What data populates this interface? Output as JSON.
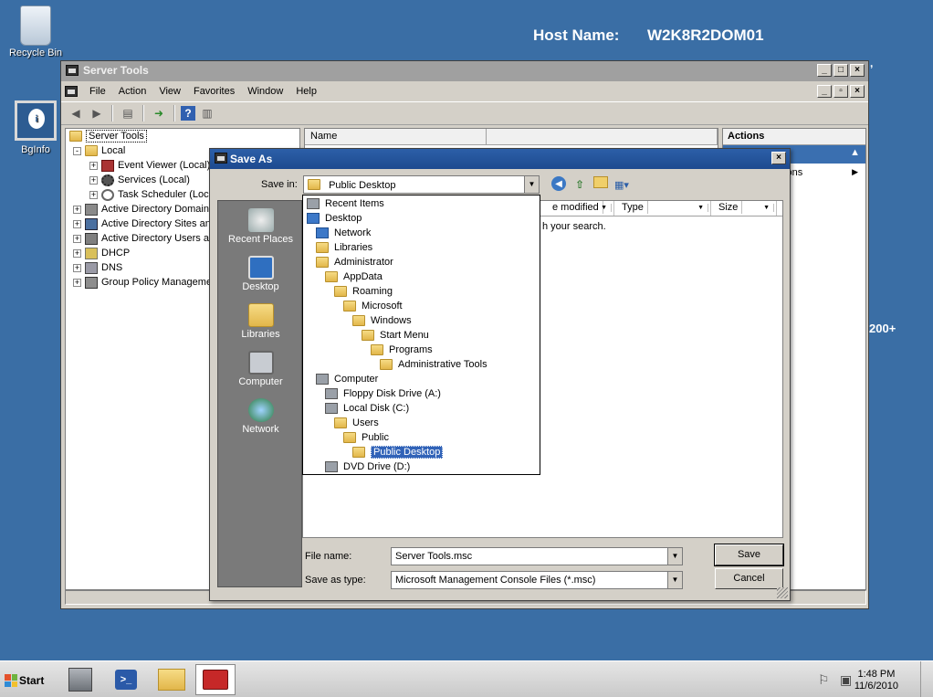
{
  "desktop": {
    "recycle_bin": "Recycle Bin",
    "bginfo": "BgInfo",
    "host_label": "Host Name:",
    "host_value": "W2K8R2DOM01",
    "fragment_comma": ",",
    "fragment_200": "200+"
  },
  "mmc": {
    "title": "Server Tools",
    "menu": [
      "File",
      "Action",
      "View",
      "Favorites",
      "Window",
      "Help"
    ],
    "tree": [
      {
        "label": "Server Tools",
        "level": 0,
        "expander": ""
      },
      {
        "label": "Local",
        "level": 1,
        "expander": "-"
      },
      {
        "label": "Event Viewer (Local)",
        "level": 2,
        "expander": "+"
      },
      {
        "label": "Services (Local)",
        "level": 2,
        "expander": "+"
      },
      {
        "label": "Task Scheduler (Local)",
        "level": 2,
        "expander": "+"
      },
      {
        "label": "Active Directory Domains and Trusts",
        "level": 1,
        "expander": "+"
      },
      {
        "label": "Active Directory Sites and Services",
        "level": 1,
        "expander": "+"
      },
      {
        "label": "Active Directory Users and Computers",
        "level": 1,
        "expander": "+"
      },
      {
        "label": "DHCP",
        "level": 1,
        "expander": "+"
      },
      {
        "label": "DNS",
        "level": 1,
        "expander": "+"
      },
      {
        "label": "Group Policy Management",
        "level": 1,
        "expander": "+"
      }
    ],
    "center_header": "Name",
    "actions_header": "Actions",
    "actions_more": "tions"
  },
  "dialog": {
    "title": "Save As",
    "save_in_label": "Save in:",
    "save_in_value": "Public Desktop",
    "places": [
      "Recent Places",
      "Desktop",
      "Libraries",
      "Computer",
      "Network"
    ],
    "columns": [
      "e modified",
      "Type",
      "Size"
    ],
    "empty_text": "h your search.",
    "file_name_label": "File name:",
    "file_name_value": "Server Tools.msc",
    "save_type_label": "Save as type:",
    "save_type_value": "Microsoft Management Console Files (*.msc)",
    "save_button": "Save",
    "cancel_button": "Cancel",
    "dropdown": [
      {
        "label": "Recent Items",
        "icon": "recent-items-icon"
      },
      {
        "label": "Desktop",
        "icon": "desktop-icon"
      },
      {
        "label": "Network",
        "icon": "network-icon"
      },
      {
        "label": "Libraries",
        "icon": "libraries-icon"
      },
      {
        "label": "Administrator",
        "icon": "user-folder-icon"
      },
      {
        "label": "AppData",
        "icon": "folder-icon"
      },
      {
        "label": "Roaming",
        "icon": "folder-icon"
      },
      {
        "label": "Microsoft",
        "icon": "folder-icon"
      },
      {
        "label": "Windows",
        "icon": "folder-icon"
      },
      {
        "label": "Start Menu",
        "icon": "folder-icon"
      },
      {
        "label": "Programs",
        "icon": "folder-icon"
      },
      {
        "label": "Administrative Tools",
        "icon": "folder-icon"
      },
      {
        "label": "Computer",
        "icon": "computer-icon"
      },
      {
        "label": "Floppy Disk Drive (A:)",
        "icon": "floppy-drive-icon"
      },
      {
        "label": "Local Disk (C:)",
        "icon": "hard-disk-icon"
      },
      {
        "label": "Users",
        "icon": "folder-icon"
      },
      {
        "label": "Public",
        "icon": "folder-icon"
      },
      {
        "label": "Public Desktop",
        "icon": "folder-icon"
      },
      {
        "label": "DVD Drive (D:)",
        "icon": "dvd-drive-icon"
      }
    ]
  },
  "taskbar": {
    "start": "Start",
    "time": "1:48 PM",
    "date": "11/6/2010"
  },
  "colors": {
    "desktop": "#3a6ea5",
    "dialog_title": "#1d4a8f",
    "selection": "#3163b8"
  }
}
